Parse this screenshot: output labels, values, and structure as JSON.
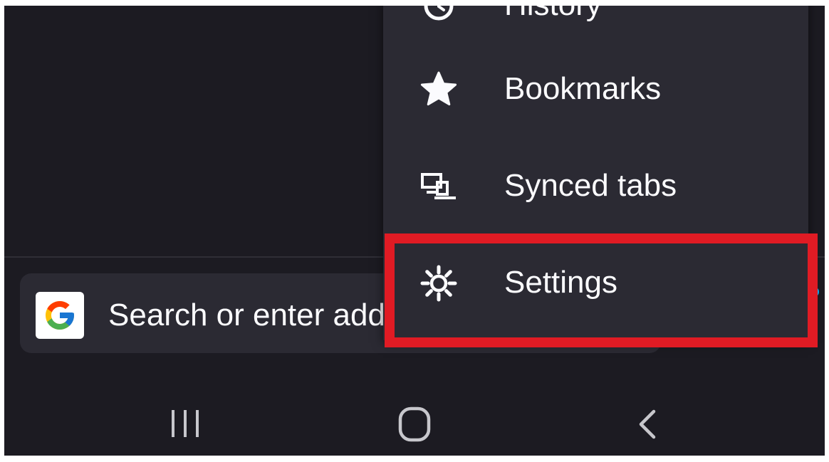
{
  "address_bar": {
    "search_engine_icon": "google-g-icon",
    "placeholder": "Search or enter address",
    "visible_text": "Search or enter add"
  },
  "menu": {
    "items": [
      {
        "label": "History",
        "icon": "history-icon"
      },
      {
        "label": "Bookmarks",
        "icon": "star-icon"
      },
      {
        "label": "Synced tabs",
        "icon": "synced-tabs-icon"
      },
      {
        "label": "Settings",
        "icon": "gear-icon"
      }
    ],
    "highlighted_item": "Settings"
  },
  "navigation_bar": {
    "recents_icon": "recents-icon",
    "home_icon": "home-icon",
    "back_icon": "back-chevron-icon"
  },
  "colors": {
    "background": "#1c1b22",
    "surface": "#2b2a33",
    "text": "#fbfbfe",
    "highlight": "#e01b24",
    "accent": "#0dabf1"
  }
}
